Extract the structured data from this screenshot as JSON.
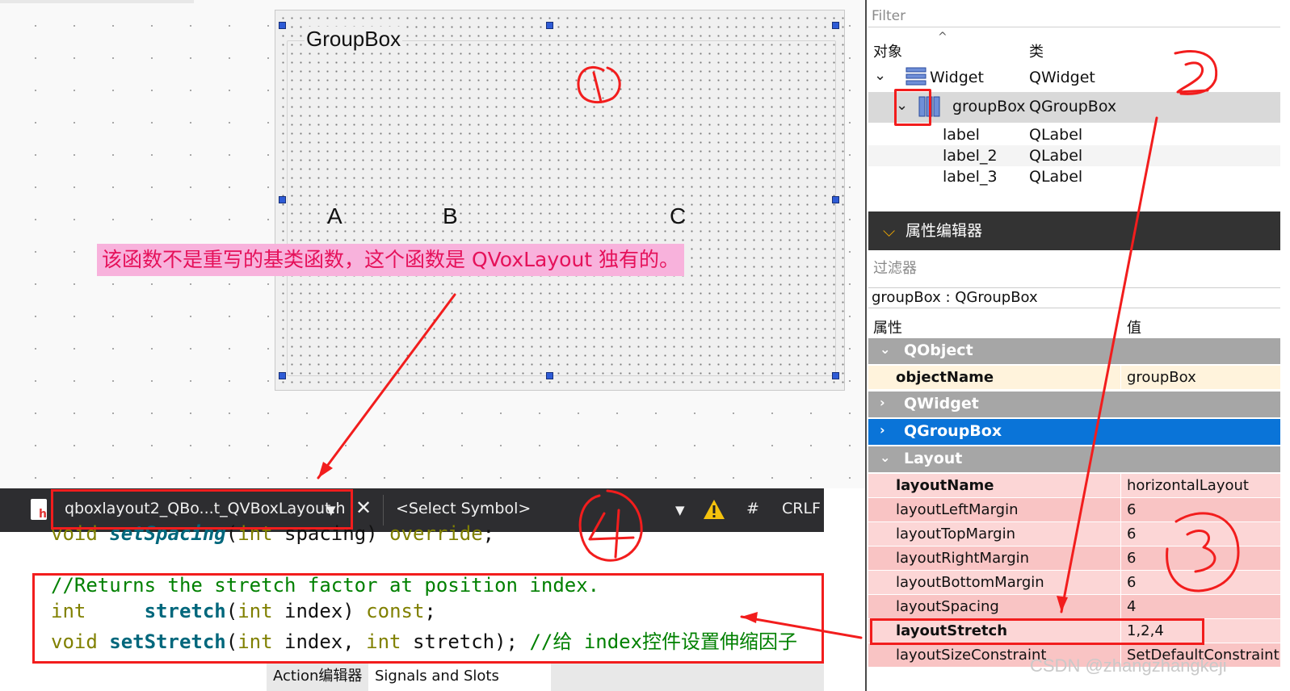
{
  "designer": {
    "groupbox_title": "GroupBox",
    "labels": [
      "A",
      "B",
      "C"
    ],
    "annotation": "该函数不是重写的基类函数，这个函数是 QVoxLayout 独有的。"
  },
  "object_inspector": {
    "filter_placeholder": "Filter",
    "col_object": "对象",
    "col_class": "类",
    "rows": [
      {
        "name": "Widget",
        "cls": "QWidget"
      },
      {
        "name": "groupBox",
        "cls": "QGroupBox"
      },
      {
        "name": "label",
        "cls": "QLabel"
      },
      {
        "name": "label_2",
        "cls": "QLabel"
      },
      {
        "name": "label_3",
        "cls": "QLabel"
      }
    ]
  },
  "property_editor": {
    "title": "属性编辑器",
    "filter_placeholder": "过滤器",
    "object_label": "groupBox : QGroupBox",
    "col_property": "属性",
    "col_value": "值",
    "categories": {
      "qobject": "QObject",
      "qwidget": "QWidget",
      "qgroupbox": "QGroupBox",
      "layout": "Layout"
    },
    "object_name": {
      "name": "objectName",
      "value": "groupBox"
    },
    "layout_props": [
      {
        "name": "layoutName",
        "value": "horizontalLayout"
      },
      {
        "name": "layoutLeftMargin",
        "value": "6"
      },
      {
        "name": "layoutTopMargin",
        "value": "6"
      },
      {
        "name": "layoutRightMargin",
        "value": "6"
      },
      {
        "name": "layoutBottomMargin",
        "value": "6"
      },
      {
        "name": "layoutSpacing",
        "value": "4"
      },
      {
        "name": "layoutStretch",
        "value": "1,2,4"
      },
      {
        "name": "layoutSizeConstraint",
        "value": "SetDefaultConstraint"
      }
    ]
  },
  "editor": {
    "file": "qboxlayout2_QBo...t_QVBoxLayout.h",
    "select_symbol": "<Select Symbol>",
    "hash": "#",
    "line_ending": "CRLF",
    "code": {
      "l1": {
        "kw1": "void ",
        "fn": "setSpacing",
        "rest": "(",
        "kw2": "int",
        "rest2": " spacing) ",
        "kw3": "override",
        "end": ";"
      },
      "comment": "//Returns the stretch factor at position index.",
      "l3": {
        "kw1": "int",
        "sp": "     ",
        "fn": "stretch",
        "p1": "(",
        "kw2": "int",
        "p2": " index) ",
        "kw3": "const",
        "end": ";"
      },
      "l4": {
        "kw1": "void ",
        "fn": "setStretch",
        "p1": "(",
        "kw2": "int",
        "p2": " index, ",
        "kw3": "int",
        "p3": " stretch); ",
        "cm": "//给 index控件设置伸缩因子"
      }
    }
  },
  "bottom_tabs": [
    "Action编辑器",
    "Signals and Slots Editor"
  ],
  "watermark": "CSDN @zhangzhangkeji"
}
